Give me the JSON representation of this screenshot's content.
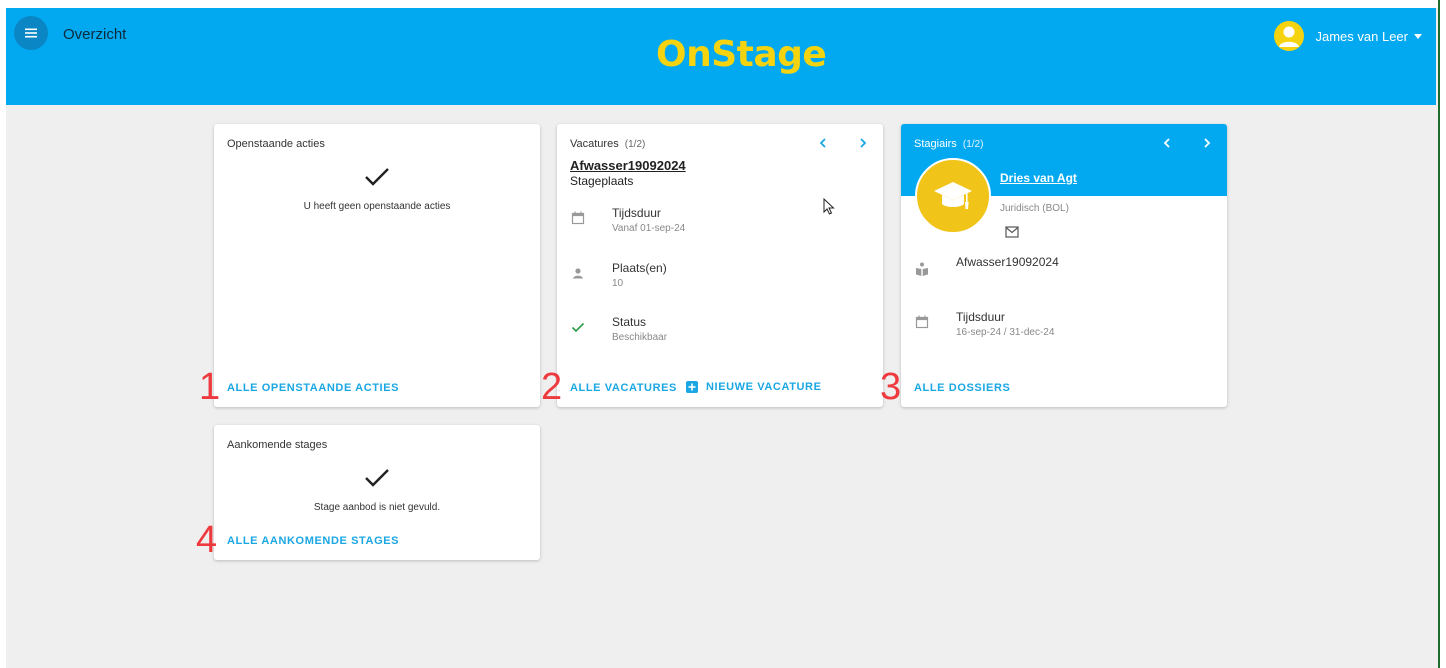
{
  "header": {
    "title": "Overzicht",
    "logo": "OnStage",
    "user_name": "James van Leer",
    "accent_color": "#03a9f0",
    "logo_color": "#f5d40f"
  },
  "cards": {
    "actions": {
      "title": "Openstaande acties",
      "message": "U heeft geen openstaande acties",
      "link": "ALLE OPENSTAANDE ACTIES"
    },
    "vacatures": {
      "title": "Vacatures",
      "count": "(1/2)",
      "name": "Afwasser19092024",
      "type": "Stageplaats",
      "details": [
        {
          "label": "Tijdsduur",
          "value": "Vanaf 01-sep-24",
          "icon": "calendar-icon"
        },
        {
          "label": "Plaats(en)",
          "value": "10",
          "icon": "person-icon"
        },
        {
          "label": "Status",
          "value": "Beschikbaar",
          "icon": "check-icon"
        }
      ],
      "link_all": "ALLE VACATURES",
      "link_new": "NIEUWE VACATURE"
    },
    "stagiairs": {
      "title": "Stagiairs",
      "count": "(1/2)",
      "name": "Dries van Agt",
      "school": "Juridisch (BOL)",
      "vacancy": "Afwasser19092024",
      "duration_label": "Tijdsduur",
      "duration_value": "16-sep-24 / 31-dec-24",
      "link": "ALLE DOSSIERS"
    },
    "upcoming": {
      "title": "Aankomende stages",
      "message": "Stage aanbod is niet gevuld.",
      "link": "ALLE AANKOMENDE STAGES"
    }
  },
  "annotations": [
    "1",
    "2",
    "3",
    "4"
  ]
}
